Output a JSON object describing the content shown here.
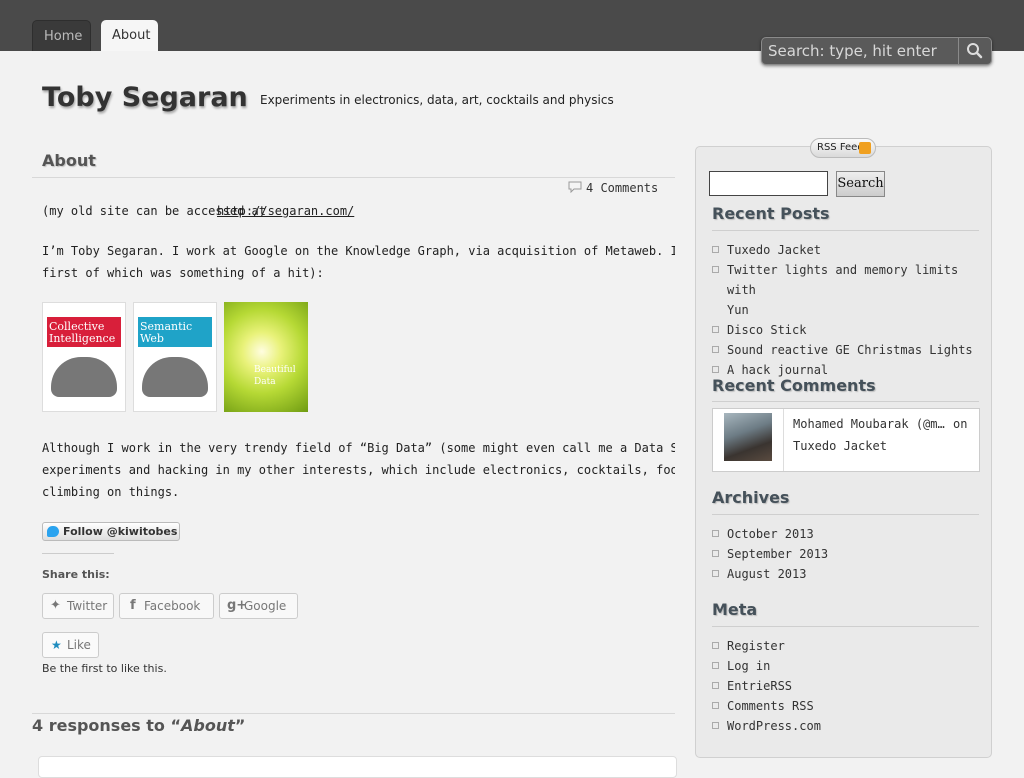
{
  "nav": {
    "tabs": [
      {
        "label": "Home"
      },
      {
        "label": "About"
      }
    ],
    "search_placeholder": "Search: type, hit enter"
  },
  "header": {
    "site_title": "Toby Segaran",
    "tagline": "Experiments in electronics, data, art, cocktails and physics"
  },
  "post": {
    "title": "About",
    "comments_link": "4 Comments",
    "old_site_prefix": "(my old site can be accessed at ",
    "old_site_link": "http://segaran.com/",
    "para1": "I’m Toby Segaran. I work at Google on the Knowledge Graph, via acquisition of Metaweb. I wr",
    "para1_line2": "first of which was something of a hit):",
    "books": [
      {
        "title": "Collective Intelligence"
      },
      {
        "title": "Semantic Web"
      },
      {
        "title": "Beautiful Data"
      }
    ],
    "para2_line1": "Although I work in the very trendy field of “Big Data” (some might even call me a Data Scie",
    "para2_line2": "experiments and hacking in my other interests, which include electronics, cocktails, food g",
    "para2_line3": "climbing on things.",
    "follow_label": "Follow @kiwitobes"
  },
  "share": {
    "title": "Share this:",
    "buttons": [
      {
        "label": "Twitter"
      },
      {
        "label": "Facebook"
      },
      {
        "label": "Google"
      }
    ],
    "like_label": "Like",
    "like_note": "Be the first to like this."
  },
  "responses": {
    "prefix": "4 responses to “",
    "post": "About",
    "suffix": "”"
  },
  "sidebar": {
    "rss_label": "RSS Feed",
    "search_button": "Search",
    "recent_posts": {
      "title": "Recent Posts",
      "items": [
        "Tuxedo Jacket",
        "Twitter lights and memory limits with",
        "Yun",
        "Disco Stick",
        "Sound reactive GE Christmas Lights",
        "A hack journal"
      ]
    },
    "recent_comments": {
      "title": "Recent Comments",
      "author": "Mohamed Moubarak (@m…",
      "on": "on",
      "post": "Tuxedo Jacket"
    },
    "archives": {
      "title": "Archives",
      "items": [
        "October 2013",
        "September 2013",
        "August 2013"
      ]
    },
    "meta": {
      "title": "Meta",
      "items": [
        "Register",
        "Log in",
        "EntrieRSS",
        "Comments RSS",
        "WordPress.com"
      ]
    }
  }
}
